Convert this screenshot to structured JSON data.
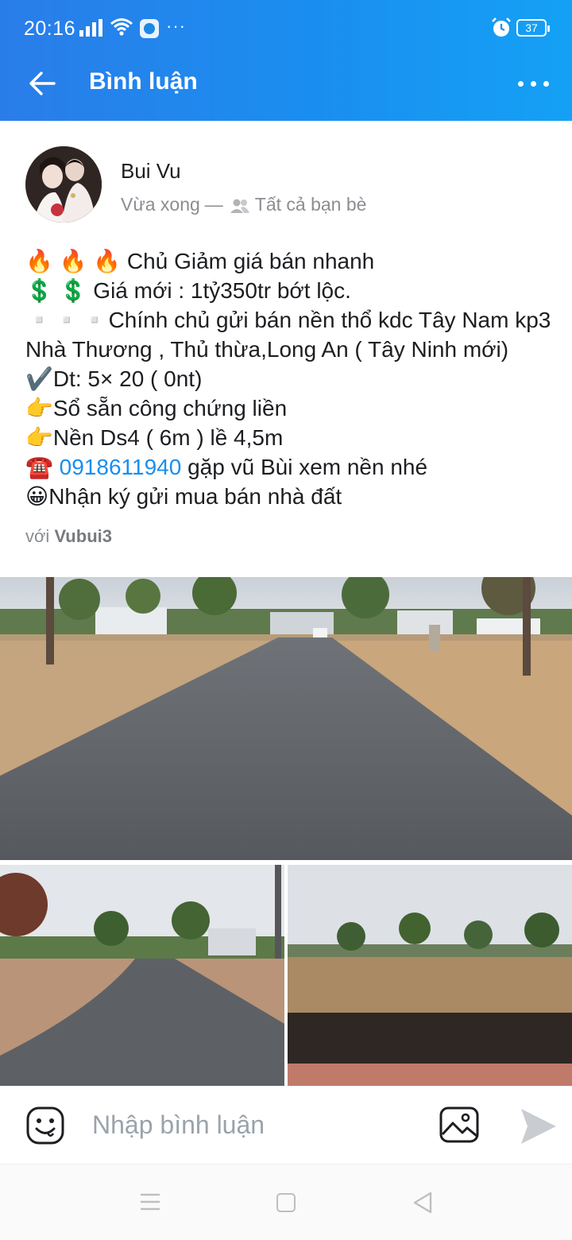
{
  "status_bar": {
    "time": "20:16",
    "more": "···",
    "battery": "37",
    "icons": [
      "signal-icon",
      "wifi-icon",
      "app-notification-icon",
      "alarm-icon",
      "battery-icon"
    ]
  },
  "header": {
    "title": "Bình luận",
    "back_icon": "arrow-left-icon",
    "menu_icon": "more-horizontal-icon"
  },
  "post": {
    "author": "Bui Vu",
    "time": "Vừa xong",
    "separator": "—",
    "privacy": "Tất cả bạn bè",
    "lines": [
      "🔥 🔥 🔥 Chủ Giảm giá bán nhanh",
      "💲 💲  Giá mới : 1tỷ350tr bớt lộc.",
      "▫️▫️▫️Chính chủ gửi bán nền thổ kdc Tây Nam kp3",
      "Nhà Thương , Thủ thừa,Long An ( Tây Ninh mới)",
      "✔️Dt: 5× 20 ( 0nt)",
      "👉Sổ sẵn công chứng liền",
      "👉Nền Ds4 ( 6m ) lề 4,5m"
    ],
    "phone_prefix": "☎️ ",
    "phone": "0918611940",
    "phone_suffix": " gặp vũ Bùi xem nền nhé",
    "last_line": "😀Nhận ký gửi mua bán nhà đất",
    "with_label": "với",
    "tagged": "Vubui3"
  },
  "comment_bar": {
    "placeholder": "Nhập bình luận"
  },
  "colors": {
    "header_gradient_start": "#2a7de9",
    "header_gradient_end": "#14a1f5",
    "link": "#1a8ef0",
    "muted": "#8a8d91"
  }
}
